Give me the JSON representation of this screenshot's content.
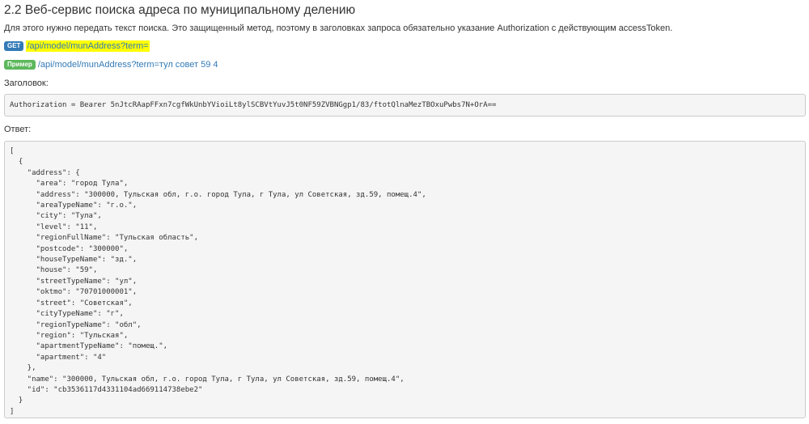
{
  "section": {
    "title": "2.2 Веб-сервис поиска адреса по муниципальному делению",
    "description": "Для этого нужно передать текст поиска. Это защищенный метод, поэтому в заголовках запроса обязательно указание Authorization с действующим accessToken."
  },
  "endpoint": {
    "method": "GET",
    "path": "/api/model/munAddress?term="
  },
  "example": {
    "badge": "Пример",
    "link": "/api/model/munAddress?term=тул совет 59 4"
  },
  "header": {
    "label": "Заголовок:",
    "code": "Authorization = Bearer 5nJtcRAapFFxn7cgfWkUnbYVioiLt8ylSCBVtYuvJ5t0NF59ZVBNGgp1/83/ftotQlnaMezTBOxuPwbs7N+OrA=="
  },
  "response": {
    "label": "Ответ:",
    "code": "[\n  {\n    \"address\": {\n      \"area\": \"город Тула\",\n      \"address\": \"300000, Тульская обл, г.о. город Тула, г Тула, ул Советская, зд.59, помещ.4\",\n      \"areaTypeName\": \"г.о.\",\n      \"city\": \"Тула\",\n      \"level\": \"11\",\n      \"regionFullName\": \"Тульская область\",\n      \"postcode\": \"300000\",\n      \"houseTypeName\": \"зд.\",\n      \"house\": \"59\",\n      \"streetTypeName\": \"ул\",\n      \"oktmo\": \"70701000001\",\n      \"street\": \"Советская\",\n      \"cityTypeName\": \"г\",\n      \"regionTypeName\": \"обл\",\n      \"region\": \"Тульская\",\n      \"apartmentTypeName\": \"помещ.\",\n      \"apartment\": \"4\"\n    },\n    \"name\": \"300000, Тульская обл, г.о. город Тула, г Тула, ул Советская, зд.59, помещ.4\",\n    \"id\": \"cb3536117d4331104ad669114738ebe2\"\n  }\n]"
  },
  "colors": {
    "get_badge": "#337ab7",
    "example_badge": "#5cb85c",
    "link": "#337ab7",
    "highlight": "#ffff00",
    "code_background": "#f5f5f5"
  }
}
